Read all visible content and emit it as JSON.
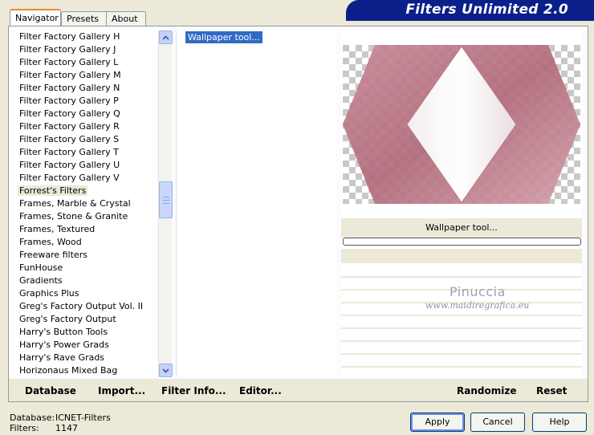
{
  "banner_title": "Filters Unlimited 2.0",
  "tabs": [
    {
      "label": "Navigator",
      "active": true
    },
    {
      "label": "Presets",
      "active": false
    },
    {
      "label": "About",
      "active": false
    }
  ],
  "categories": [
    "Filter Factory Gallery H",
    "Filter Factory Gallery J",
    "Filter Factory Gallery L",
    "Filter Factory Gallery M",
    "Filter Factory Gallery N",
    "Filter Factory Gallery P",
    "Filter Factory Gallery Q",
    "Filter Factory Gallery R",
    "Filter Factory Gallery S",
    "Filter Factory Gallery T",
    "Filter Factory Gallery U",
    "Filter Factory Gallery V",
    "Forrest's Filters",
    "Frames, Marble & Crystal",
    "Frames, Stone & Granite",
    "Frames, Textured",
    "Frames, Wood",
    "Freeware filters",
    "FunHouse",
    "Gradients",
    "Graphics Plus",
    "Greg's Factory Output Vol. II",
    "Greg's Factory Output",
    "Harry's Button Tools",
    "Harry's Power Grads",
    "Harry's Rave Grads",
    "Horizonaus Mixed Bag"
  ],
  "selected_category": "Forrest's Filters",
  "filters": [
    "Wallpaper tool..."
  ],
  "selected_filter": "Wallpaper tool...",
  "preview": {
    "caption": "Wallpaper tool...",
    "watermark_name": "Pinuccia",
    "watermark_url": "www.maidiregrafica.eu",
    "shape_color": "#b9707f"
  },
  "toolbar": {
    "database": "Database",
    "import": "Import...",
    "filter_info": "Filter Info...",
    "editor": "Editor...",
    "randomize": "Randomize",
    "reset": "Reset"
  },
  "footer": {
    "database_label": "Database:",
    "database_value": "ICNET-Filters",
    "filters_label": "Filters:",
    "filters_value": "1147"
  },
  "buttons": {
    "apply": "Apply",
    "cancel": "Cancel",
    "help": "Help"
  }
}
